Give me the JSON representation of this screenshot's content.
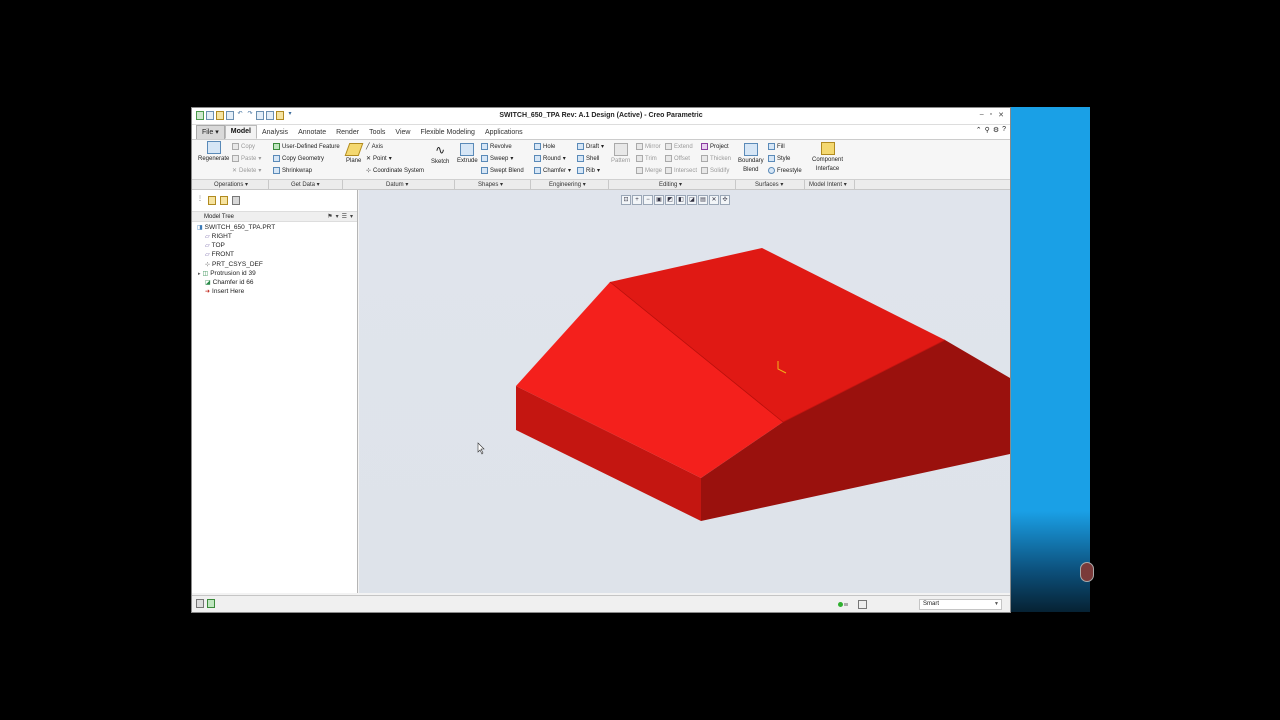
{
  "window": {
    "title": "SWITCH_650_TPA Rev: A.1 Design  (Active) - Creo Parametric"
  },
  "tabs": [
    "File",
    "Model",
    "Analysis",
    "Annotate",
    "Render",
    "Tools",
    "View",
    "Flexible Modeling",
    "Applications"
  ],
  "active_tab": "Model",
  "ribbon": {
    "regenerate": "Regenerate",
    "copy": "Copy",
    "paste": "Paste",
    "delete": "Delete",
    "user_defined_feature": "User-Defined Feature",
    "copy_geometry": "Copy Geometry",
    "shrinkwrap": "Shrinkwrap",
    "plane": "Plane",
    "axis": "Axis",
    "point": "Point",
    "coordinate_system": "Coordinate System",
    "sketch": "Sketch",
    "extrude": "Extrude",
    "revolve": "Revolve",
    "sweep": "Sweep",
    "swept_blend": "Swept Blend",
    "hole": "Hole",
    "round": "Round",
    "chamfer": "Chamfer",
    "draft": "Draft",
    "shell": "Shell",
    "rib": "Rib",
    "pattern": "Pattern",
    "mirror": "Mirror",
    "trim": "Trim",
    "merge": "Merge",
    "extend": "Extend",
    "offset": "Offset",
    "intersect": "Intersect",
    "project": "Project",
    "thicken": "Thicken",
    "solidify": "Solidify",
    "boundary_blend_1": "Boundary",
    "boundary_blend_2": "Blend",
    "fill": "Fill",
    "style": "Style",
    "freestyle": "Freestyle",
    "component_interface_1": "Component",
    "component_interface_2": "Interface"
  },
  "groups": [
    "Operations ▾",
    "Get Data ▾",
    "Datum ▾",
    "Shapes ▾",
    "Engineering ▾",
    "Editing ▾",
    "Surfaces ▾",
    "Model Intent ▾"
  ],
  "model_tree": {
    "title": "Model Tree",
    "items": [
      "SWITCH_650_TPA.PRT",
      "RIGHT",
      "TOP",
      "FRONT",
      "PRT_CSYS_DEF",
      "Protrusion id 39",
      "Chamfer id 66",
      "Insert Here"
    ]
  },
  "status": {
    "filter": "Smart"
  },
  "model_colors": {
    "top_left": "#f4201c",
    "top_right": "#e01914",
    "front": "#c41611",
    "right_front": "#9a110d",
    "right_side": "#a8120e"
  }
}
